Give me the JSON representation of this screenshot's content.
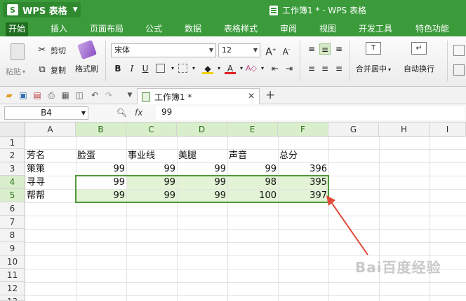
{
  "app": {
    "name": "WPS 表格",
    "logo_letter": "S"
  },
  "window": {
    "title": "工作簿1 * - WPS 表格"
  },
  "menu": [
    "开始",
    "插入",
    "页面布局",
    "公式",
    "数据",
    "表格样式",
    "审阅",
    "视图",
    "开发工具",
    "特色功能"
  ],
  "ribbon": {
    "paste": "粘贴",
    "cut": "剪切",
    "copy": "复制",
    "format_painter": "格式刷",
    "font_name": "宋体",
    "font_size": "12",
    "merge_center": "合并居中",
    "wrap_text": "自动换行"
  },
  "doc_tab": {
    "name": "工作簿1 *"
  },
  "formula_bar": {
    "cell_ref": "B4",
    "fx": "fx",
    "value": "99"
  },
  "sheet": {
    "columns": [
      "A",
      "B",
      "C",
      "D",
      "E",
      "F",
      "G",
      "H",
      "I"
    ],
    "rows": [
      "1",
      "2",
      "3",
      "4",
      "5",
      "6",
      "7",
      "8",
      "9",
      "10",
      "11",
      "12",
      "13"
    ],
    "cells": {
      "A2": "芳名",
      "B2": "脸蛋",
      "C2": "事业线",
      "D2": "美腿",
      "E2": "声音",
      "F2": "总分",
      "A3": "策策",
      "B3": "99",
      "C3": "99",
      "D3": "99",
      "E3": "99",
      "F3": "396",
      "A4": "寻寻",
      "B4": "99",
      "C4": "99",
      "D4": "99",
      "E4": "98",
      "F4": "395",
      "A5": "帮帮",
      "B5": "99",
      "C5": "99",
      "D5": "99",
      "E5": "100",
      "F5": "397"
    }
  },
  "watermark": "Bai百度经验",
  "colors": {
    "accent": "#3b9b3b",
    "selection": "#4f9a3a",
    "arrow": "#e04a3a"
  }
}
